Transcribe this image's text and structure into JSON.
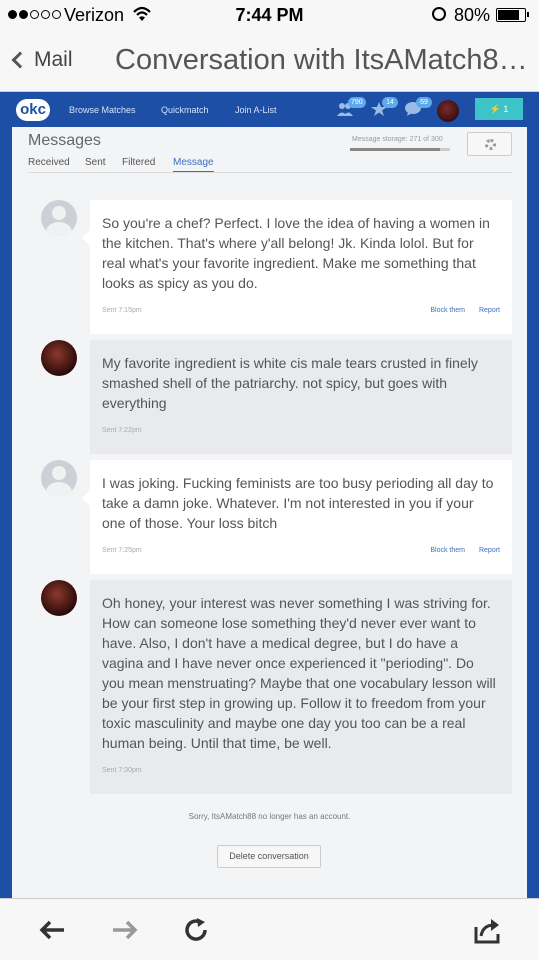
{
  "status_bar": {
    "carrier": "Verizon",
    "time": "7:44 PM",
    "battery": "80%"
  },
  "nav_bar": {
    "back_label": "Mail",
    "title": "Conversation with ItsAMatch8…"
  },
  "okc_header": {
    "logo": "okc",
    "links": [
      "Browse Matches",
      "Quickmatch",
      "Join A-List"
    ],
    "badges": {
      "visitors": "790",
      "likes": "14",
      "messages": "69"
    },
    "boost_count": "1"
  },
  "messages_page": {
    "title": "Messages",
    "storage_label": "Message storage: 271 of 300",
    "storage_fraction": 0.9,
    "tabs": [
      "Received",
      "Sent",
      "Filtered",
      "Message"
    ],
    "active_tab": "Message"
  },
  "conversation": [
    {
      "from": "them",
      "text": "So you're a chef? Perfect. I love the idea of having a women in the kitchen. That's where y'all belong! Jk. Kinda lolol. But for real what's your favorite ingredient. Make me something that looks as spicy as you do.",
      "sent": "Sent 7:15pm",
      "actions": [
        "Block them",
        "Report"
      ]
    },
    {
      "from": "me",
      "text": "My favorite ingredient is white cis male tears crusted in finely smashed shell of the patriarchy. not spicy, but goes with everything",
      "sent": "Sent 7:22pm"
    },
    {
      "from": "them",
      "text": "I was joking. Fucking feminists are too busy perioding all day to take a damn joke. Whatever. I'm not interested in you if your one of those. Your loss bitch",
      "sent": "Sent 7:25pm",
      "actions": [
        "Block them",
        "Report"
      ]
    },
    {
      "from": "me",
      "text": "Oh honey, your interest was never something I was striving for. How can someone lose something they'd never ever want to have. Also, I don't have a medical degree, but I do have a vagina and I have never once experienced it \"perioding\". Do you mean menstruating? Maybe that one vocabulary lesson will be your first step in growing up. Follow it to freedom from your toxic masculinity and maybe one day you too can be a real human being. Until that time, be well.",
      "sent": "Sent 7:30pm"
    }
  ],
  "notice": "Sorry, ItsAMatch88 no longer has an account.",
  "delete_button": "Delete conversation",
  "toolbar_icons": [
    "back-arrow-icon",
    "forward-arrow-icon",
    "reload-icon",
    "share-icon"
  ],
  "colors": {
    "okc_blue": "#1d4fa7",
    "link_blue": "#3c6fc1",
    "boost_teal": "#3ec4c8",
    "badge_blue": "#5ea8ec"
  }
}
